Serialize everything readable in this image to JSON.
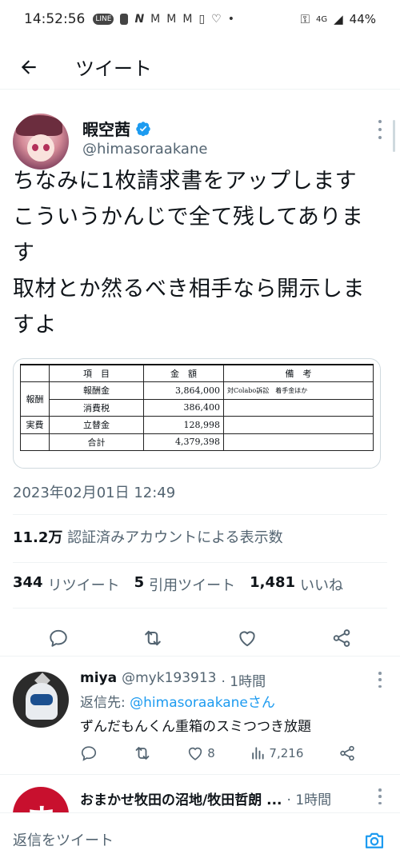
{
  "status_bar": {
    "time": "14:52:56",
    "notif_icons": [
      "LINE",
      "N",
      "M",
      "M",
      "M"
    ],
    "network": "4G",
    "battery": "44%"
  },
  "header": {
    "title": "ツイート"
  },
  "tweet": {
    "display_name": "暇空茜",
    "handle": "@himasoraakane",
    "text": "ちなみに1枚請求書をアップします\nこういうかんじで全て残してありま\nす\n取材とか然るべき相手なら開示しま\nすよ",
    "media_table": {
      "headers": [
        "項　目",
        "金　額",
        "備　考"
      ],
      "rows": [
        {
          "group": "報酬",
          "item": "報酬金",
          "amount": "3,864,000",
          "note": "対Colabo訴訟　着手金ほか"
        },
        {
          "group": "",
          "item": "消費税",
          "amount": "386,400",
          "note": ""
        },
        {
          "group": "実費",
          "item": "立替金",
          "amount": "128,998",
          "note": ""
        },
        {
          "group": "",
          "item": "合計",
          "amount": "4,379,398",
          "note": ""
        }
      ]
    },
    "timestamp": "2023年02月01日 12:49",
    "views_count": "11.2万",
    "views_label": "認証済みアカウントによる表示数",
    "retweets_count": "344",
    "retweets_label": "リツイート",
    "quotes_count": "5",
    "quotes_label": "引用ツイート",
    "likes_count": "1,481",
    "likes_label": "いいね"
  },
  "replies": [
    {
      "name": "miya",
      "handle": "@myk193913",
      "time": "· 1時間",
      "reply_to_prefix": "返信先: ",
      "reply_to_handle": "@himasoraakane",
      "reply_to_suffix": "さん",
      "text": "ずんだもんくん重箱のスミつつき放題",
      "likes": "8",
      "views": "7,216"
    },
    {
      "name": "おまかせ牧田の沼地/牧田哲朗 ...",
      "time": "· 1時間",
      "avatar_glyph": "ま"
    }
  ],
  "compose": {
    "placeholder": "返信をツイート"
  },
  "colors": {
    "accent": "#1d9bf0",
    "text": "#0f1419",
    "secondary": "#536471"
  }
}
